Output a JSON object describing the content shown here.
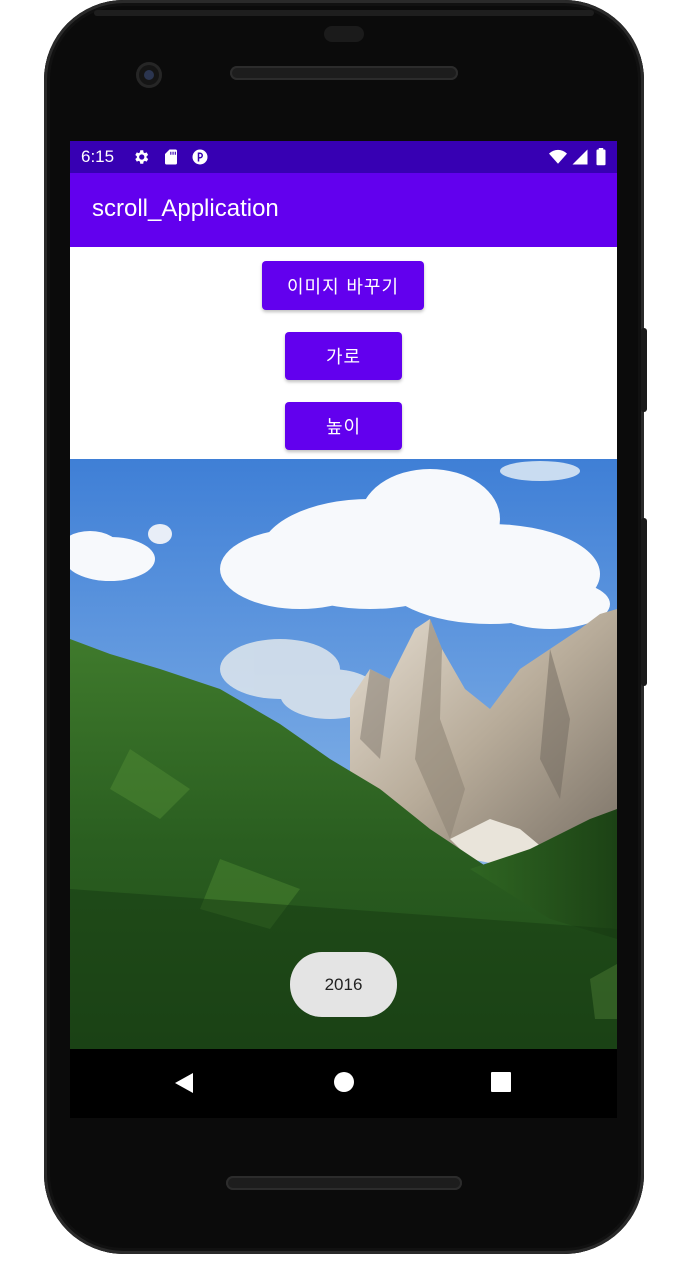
{
  "status_bar": {
    "time": "6:15",
    "left_icons": [
      "gear-icon",
      "sd-card-icon",
      "app-notification-icon"
    ],
    "right_icons": [
      "wifi-icon",
      "cell-signal-icon",
      "battery-icon"
    ],
    "color": "#3700b3"
  },
  "app_bar": {
    "title": "scroll_Application",
    "color": "#6200ee"
  },
  "buttons": {
    "change_image": "이미지 바꾸기",
    "width": "가로",
    "height": "높이"
  },
  "image": {
    "description_icon": "mountain-landscape-image"
  },
  "toast": {
    "text": "2016"
  },
  "nav": {
    "icons": [
      "back-icon",
      "home-icon",
      "recents-icon"
    ]
  }
}
